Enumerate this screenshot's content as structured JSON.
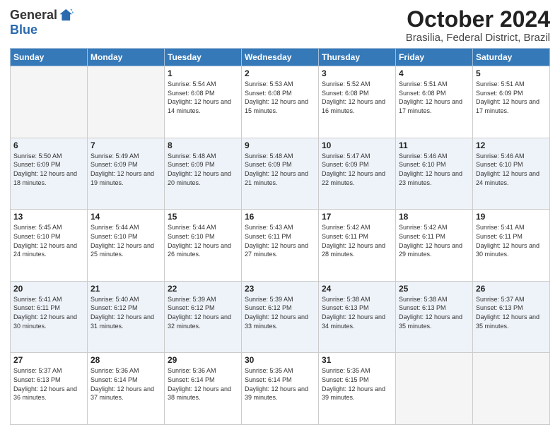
{
  "header": {
    "logo_general": "General",
    "logo_blue": "Blue",
    "month_title": "October 2024",
    "location": "Brasilia, Federal District, Brazil"
  },
  "weekdays": [
    "Sunday",
    "Monday",
    "Tuesday",
    "Wednesday",
    "Thursday",
    "Friday",
    "Saturday"
  ],
  "weeks": [
    [
      {
        "day": "",
        "sunrise": "",
        "sunset": "",
        "daylight": ""
      },
      {
        "day": "",
        "sunrise": "",
        "sunset": "",
        "daylight": ""
      },
      {
        "day": "1",
        "sunrise": "Sunrise: 5:54 AM",
        "sunset": "Sunset: 6:08 PM",
        "daylight": "Daylight: 12 hours and 14 minutes."
      },
      {
        "day": "2",
        "sunrise": "Sunrise: 5:53 AM",
        "sunset": "Sunset: 6:08 PM",
        "daylight": "Daylight: 12 hours and 15 minutes."
      },
      {
        "day": "3",
        "sunrise": "Sunrise: 5:52 AM",
        "sunset": "Sunset: 6:08 PM",
        "daylight": "Daylight: 12 hours and 16 minutes."
      },
      {
        "day": "4",
        "sunrise": "Sunrise: 5:51 AM",
        "sunset": "Sunset: 6:08 PM",
        "daylight": "Daylight: 12 hours and 17 minutes."
      },
      {
        "day": "5",
        "sunrise": "Sunrise: 5:51 AM",
        "sunset": "Sunset: 6:09 PM",
        "daylight": "Daylight: 12 hours and 17 minutes."
      }
    ],
    [
      {
        "day": "6",
        "sunrise": "Sunrise: 5:50 AM",
        "sunset": "Sunset: 6:09 PM",
        "daylight": "Daylight: 12 hours and 18 minutes."
      },
      {
        "day": "7",
        "sunrise": "Sunrise: 5:49 AM",
        "sunset": "Sunset: 6:09 PM",
        "daylight": "Daylight: 12 hours and 19 minutes."
      },
      {
        "day": "8",
        "sunrise": "Sunrise: 5:48 AM",
        "sunset": "Sunset: 6:09 PM",
        "daylight": "Daylight: 12 hours and 20 minutes."
      },
      {
        "day": "9",
        "sunrise": "Sunrise: 5:48 AM",
        "sunset": "Sunset: 6:09 PM",
        "daylight": "Daylight: 12 hours and 21 minutes."
      },
      {
        "day": "10",
        "sunrise": "Sunrise: 5:47 AM",
        "sunset": "Sunset: 6:09 PM",
        "daylight": "Daylight: 12 hours and 22 minutes."
      },
      {
        "day": "11",
        "sunrise": "Sunrise: 5:46 AM",
        "sunset": "Sunset: 6:10 PM",
        "daylight": "Daylight: 12 hours and 23 minutes."
      },
      {
        "day": "12",
        "sunrise": "Sunrise: 5:46 AM",
        "sunset": "Sunset: 6:10 PM",
        "daylight": "Daylight: 12 hours and 24 minutes."
      }
    ],
    [
      {
        "day": "13",
        "sunrise": "Sunrise: 5:45 AM",
        "sunset": "Sunset: 6:10 PM",
        "daylight": "Daylight: 12 hours and 24 minutes."
      },
      {
        "day": "14",
        "sunrise": "Sunrise: 5:44 AM",
        "sunset": "Sunset: 6:10 PM",
        "daylight": "Daylight: 12 hours and 25 minutes."
      },
      {
        "day": "15",
        "sunrise": "Sunrise: 5:44 AM",
        "sunset": "Sunset: 6:10 PM",
        "daylight": "Daylight: 12 hours and 26 minutes."
      },
      {
        "day": "16",
        "sunrise": "Sunrise: 5:43 AM",
        "sunset": "Sunset: 6:11 PM",
        "daylight": "Daylight: 12 hours and 27 minutes."
      },
      {
        "day": "17",
        "sunrise": "Sunrise: 5:42 AM",
        "sunset": "Sunset: 6:11 PM",
        "daylight": "Daylight: 12 hours and 28 minutes."
      },
      {
        "day": "18",
        "sunrise": "Sunrise: 5:42 AM",
        "sunset": "Sunset: 6:11 PM",
        "daylight": "Daylight: 12 hours and 29 minutes."
      },
      {
        "day": "19",
        "sunrise": "Sunrise: 5:41 AM",
        "sunset": "Sunset: 6:11 PM",
        "daylight": "Daylight: 12 hours and 30 minutes."
      }
    ],
    [
      {
        "day": "20",
        "sunrise": "Sunrise: 5:41 AM",
        "sunset": "Sunset: 6:11 PM",
        "daylight": "Daylight: 12 hours and 30 minutes."
      },
      {
        "day": "21",
        "sunrise": "Sunrise: 5:40 AM",
        "sunset": "Sunset: 6:12 PM",
        "daylight": "Daylight: 12 hours and 31 minutes."
      },
      {
        "day": "22",
        "sunrise": "Sunrise: 5:39 AM",
        "sunset": "Sunset: 6:12 PM",
        "daylight": "Daylight: 12 hours and 32 minutes."
      },
      {
        "day": "23",
        "sunrise": "Sunrise: 5:39 AM",
        "sunset": "Sunset: 6:12 PM",
        "daylight": "Daylight: 12 hours and 33 minutes."
      },
      {
        "day": "24",
        "sunrise": "Sunrise: 5:38 AM",
        "sunset": "Sunset: 6:13 PM",
        "daylight": "Daylight: 12 hours and 34 minutes."
      },
      {
        "day": "25",
        "sunrise": "Sunrise: 5:38 AM",
        "sunset": "Sunset: 6:13 PM",
        "daylight": "Daylight: 12 hours and 35 minutes."
      },
      {
        "day": "26",
        "sunrise": "Sunrise: 5:37 AM",
        "sunset": "Sunset: 6:13 PM",
        "daylight": "Daylight: 12 hours and 35 minutes."
      }
    ],
    [
      {
        "day": "27",
        "sunrise": "Sunrise: 5:37 AM",
        "sunset": "Sunset: 6:13 PM",
        "daylight": "Daylight: 12 hours and 36 minutes."
      },
      {
        "day": "28",
        "sunrise": "Sunrise: 5:36 AM",
        "sunset": "Sunset: 6:14 PM",
        "daylight": "Daylight: 12 hours and 37 minutes."
      },
      {
        "day": "29",
        "sunrise": "Sunrise: 5:36 AM",
        "sunset": "Sunset: 6:14 PM",
        "daylight": "Daylight: 12 hours and 38 minutes."
      },
      {
        "day": "30",
        "sunrise": "Sunrise: 5:35 AM",
        "sunset": "Sunset: 6:14 PM",
        "daylight": "Daylight: 12 hours and 39 minutes."
      },
      {
        "day": "31",
        "sunrise": "Sunrise: 5:35 AM",
        "sunset": "Sunset: 6:15 PM",
        "daylight": "Daylight: 12 hours and 39 minutes."
      },
      {
        "day": "",
        "sunrise": "",
        "sunset": "",
        "daylight": ""
      },
      {
        "day": "",
        "sunrise": "",
        "sunset": "",
        "daylight": ""
      }
    ]
  ]
}
